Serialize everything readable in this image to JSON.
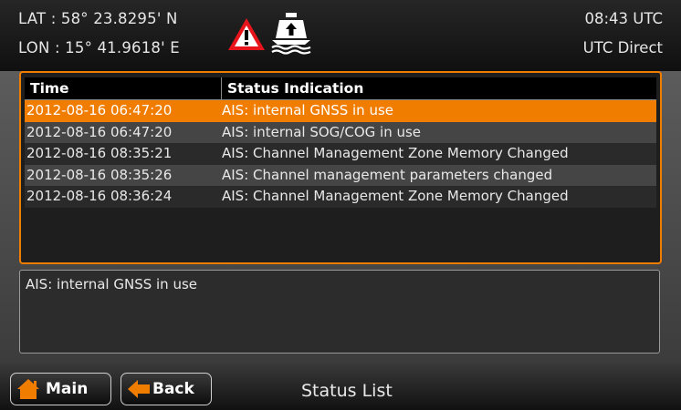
{
  "header": {
    "lat": "LAT  : 58° 23.8295' N",
    "lon": "LON : 15° 41.9618' E",
    "time": "08:43 UTC",
    "time_source": "UTC Direct",
    "icons": [
      "warning-icon",
      "ship-icon"
    ]
  },
  "status_list": {
    "columns": [
      "Time",
      "Status Indication"
    ],
    "rows": [
      {
        "time": "2012-08-16 06:47:20",
        "status": "AIS: internal GNSS in use"
      },
      {
        "time": "2012-08-16 06:47:20",
        "status": "AIS: internal SOG/COG in use"
      },
      {
        "time": "2012-08-16 08:35:21",
        "status": "AIS: Channel Management Zone Memory Changed"
      },
      {
        "time": "2012-08-16 08:35:26",
        "status": "AIS: Channel management parameters changed"
      },
      {
        "time": "2012-08-16 08:36:24",
        "status": "AIS: Channel Management Zone Memory Changed"
      }
    ],
    "selected_index": 0
  },
  "detail": {
    "text": "AIS: internal GNSS in use"
  },
  "footer": {
    "main_label": "Main",
    "back_label": "Back",
    "title": "Status List"
  },
  "colors": {
    "accent": "#f07d00",
    "warning_red": "#e8141b",
    "background": "#000000"
  }
}
